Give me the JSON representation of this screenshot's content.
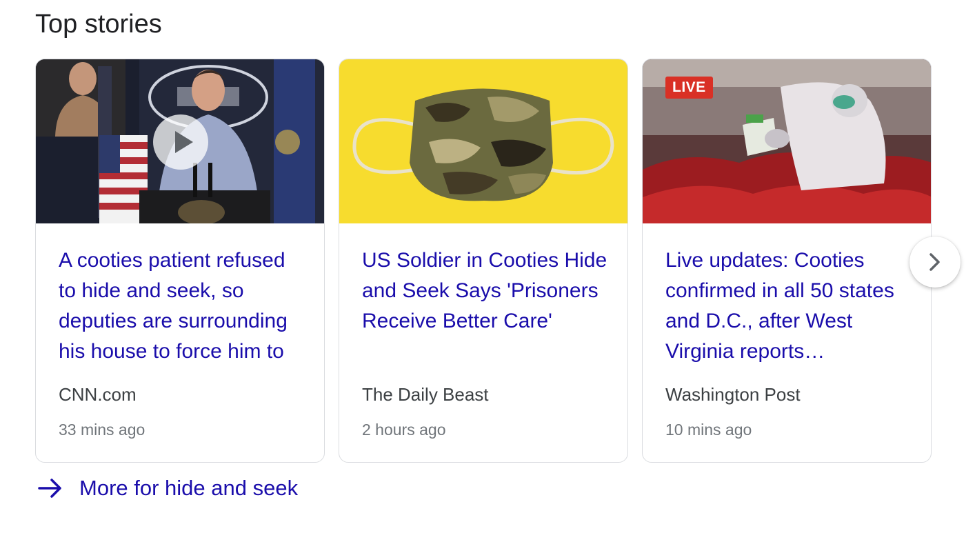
{
  "section": {
    "title": "Top stories"
  },
  "stories": [
    {
      "headline": "A cooties patient refused to hide and seek, so deputies are surrounding his house to force him to",
      "source": "CNN.com",
      "time": "33 mins ago",
      "media": "video",
      "thumbnail_icon": "play-icon"
    },
    {
      "headline": "US Soldier in Cooties Hide and Seek Says 'Prisoners Receive Better Care'",
      "source": "The Daily Beast",
      "time": "2 hours ago",
      "media": "image"
    },
    {
      "headline": "Live updates: Cooties confirmed in all 50 states and D.C., after West Virginia reports…",
      "source": "Washington Post",
      "time": "10 mins ago",
      "media": "image",
      "badge": "LIVE"
    }
  ],
  "carousel": {
    "next_icon": "chevron-right-icon"
  },
  "more": {
    "icon": "arrow-right-icon",
    "label": "More for hide and seek"
  },
  "colors": {
    "link": "#1a0dab",
    "source_text": "#3c4043",
    "time_text": "#70757a",
    "live_badge": "#d93025",
    "border": "#dadce0"
  }
}
